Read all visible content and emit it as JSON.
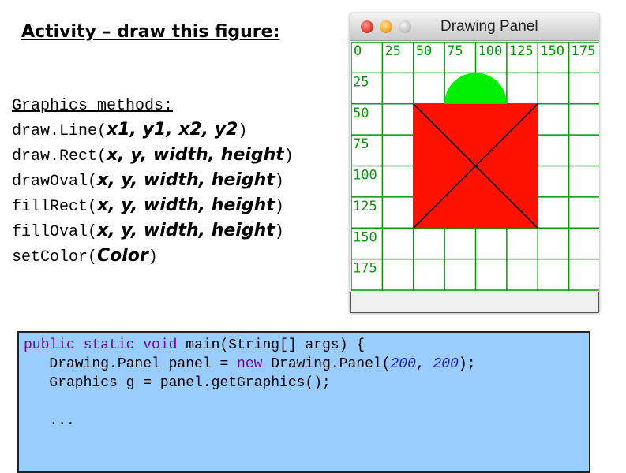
{
  "title": "Activity – draw this figure:",
  "methods": {
    "heading": "Graphics methods:",
    "items": [
      {
        "name": "draw.Line(",
        "args": "x1, y1, x2, y2",
        "close": ")"
      },
      {
        "name": "draw.Rect(",
        "args": "x, y, width, height",
        "close": ")"
      },
      {
        "name": "drawOval(",
        "args": "x, y, width, height",
        "close": ")"
      },
      {
        "name": "fillRect(",
        "args": "x, y, width, height",
        "close": ")"
      },
      {
        "name": "fillOval(",
        "args": "x, y, width, height",
        "close": ")"
      },
      {
        "name": "setColor(",
        "args": "Color",
        "close": ")"
      }
    ]
  },
  "window": {
    "title": "Drawing Panel",
    "x_ticks": [
      "0",
      "25",
      "50",
      "75",
      "100",
      "125",
      "150",
      "175"
    ],
    "y_ticks": [
      "25",
      "50",
      "75",
      "100",
      "125",
      "150",
      "175"
    ],
    "colors": {
      "grid": "#009900",
      "square": "#ff1100",
      "oval": "#00ee00",
      "lines": "#000000"
    }
  },
  "code": {
    "line1": {
      "kw1": "public",
      "kw2": "static",
      "kw3": "void",
      "rest": " main(String[] args) {"
    },
    "line2": {
      "pre": "   Drawing.Panel panel = ",
      "kw": "new",
      "mid": " Drawing.Panel(",
      "n1": "200",
      "comma": ", ",
      "n2": "200",
      "post": ");"
    },
    "line3": "   Graphics g = panel.getGraphics();",
    "line4": "   ..."
  }
}
